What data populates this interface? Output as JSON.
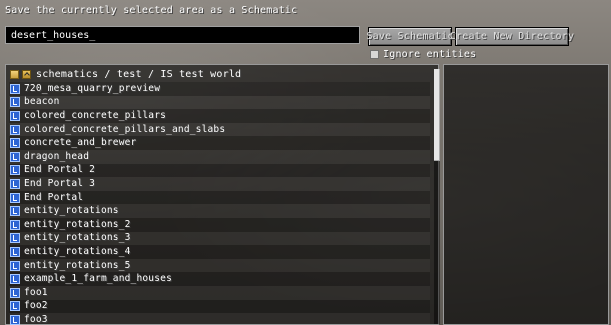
{
  "title": "Save the currently selected area as a Schematic",
  "save_form": {
    "name_value": "desert_houses_",
    "save_button_label": "Save Schematic",
    "new_dir_button_label": "Create New Directory",
    "ignore_entities_label": "Ignore entities",
    "ignore_entities_checked": false
  },
  "browser": {
    "path": "schematics / test / IS test world",
    "root_icon": "folder-root-icon",
    "up_icon": "folder-up-icon",
    "entries": [
      {
        "label": "720_mesa_quarry_preview",
        "icon": "schematic-file-icon"
      },
      {
        "label": "beacon",
        "icon": "schematic-file-icon"
      },
      {
        "label": "colored_concrete_pillars",
        "icon": "schematic-file-icon"
      },
      {
        "label": "colored_concrete_pillars_and_slabs",
        "icon": "schematic-file-icon"
      },
      {
        "label": "concrete_and_brewer",
        "icon": "schematic-file-icon"
      },
      {
        "label": "dragon_head",
        "icon": "schematic-file-icon"
      },
      {
        "label": "End Portal 2",
        "icon": "schematic-file-icon"
      },
      {
        "label": "End Portal 3",
        "icon": "schematic-file-icon"
      },
      {
        "label": "End Portal",
        "icon": "schematic-file-icon"
      },
      {
        "label": "entity_rotations",
        "icon": "schematic-file-icon"
      },
      {
        "label": "entity_rotations_2",
        "icon": "schematic-file-icon"
      },
      {
        "label": "entity_rotations_3",
        "icon": "schematic-file-icon"
      },
      {
        "label": "entity_rotations_4",
        "icon": "schematic-file-icon"
      },
      {
        "label": "entity_rotations_5",
        "icon": "schematic-file-icon"
      },
      {
        "label": "example_1_farm_and_houses",
        "icon": "schematic-file-icon"
      },
      {
        "label": "foo1",
        "icon": "schematic-file-icon"
      },
      {
        "label": "foo2",
        "icon": "schematic-file-icon"
      },
      {
        "label": "foo3",
        "icon": "schematic-file-icon"
      }
    ]
  },
  "scrollbar": {
    "position": 0
  }
}
